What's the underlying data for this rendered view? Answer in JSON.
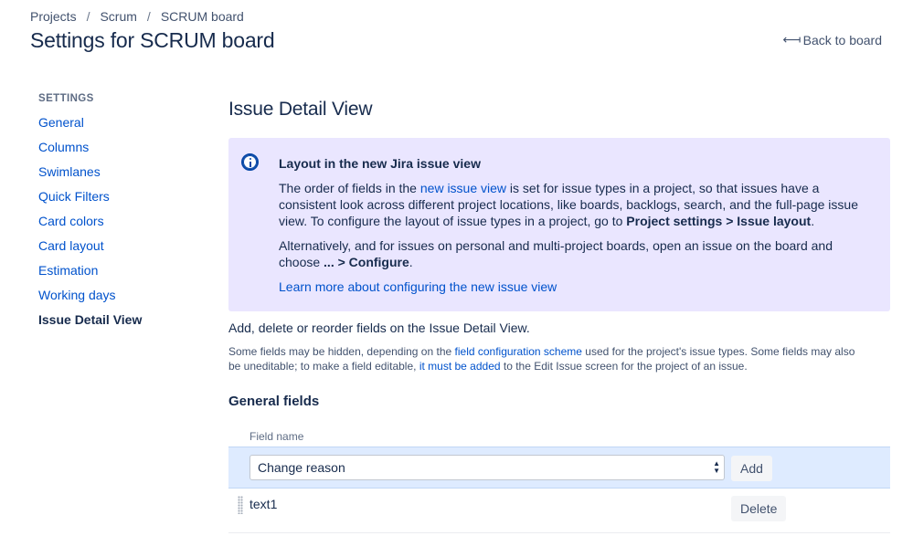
{
  "breadcrumb": [
    "Projects",
    "Scrum",
    "SCRUM board"
  ],
  "page_title": "Settings for SCRUM board",
  "back_link": "Back to board",
  "sidebar": {
    "heading": "SETTINGS",
    "items": [
      {
        "label": "General"
      },
      {
        "label": "Columns"
      },
      {
        "label": "Swimlanes"
      },
      {
        "label": "Quick Filters"
      },
      {
        "label": "Card colors"
      },
      {
        "label": "Card layout"
      },
      {
        "label": "Estimation"
      },
      {
        "label": "Working days"
      },
      {
        "label": "Issue Detail View",
        "active": true
      }
    ]
  },
  "main": {
    "heading": "Issue Detail View",
    "info": {
      "title": "Layout in the new Jira issue view",
      "p1_a": "The order of fields in the ",
      "p1_link": "new issue view",
      "p1_b": " is set for issue types in a project, so that issues have a consistent look across different project locations, like boards, backlogs, search, and the full-page issue view. To configure the layout of issue types in a project, go to ",
      "p1_bold": "Project settings > Issue layout",
      "p1_c": ".",
      "p2_a": "Alternatively, and for issues on personal and multi-project boards, open an issue on the board and choose ",
      "p2_bold": "... > Configure",
      "p2_c": ".",
      "learn_more": "Learn more about configuring the new issue view"
    },
    "desc1": "Add, delete or reorder fields on the Issue Detail View.",
    "desc2": {
      "a": "Some fields may be hidden, depending on the ",
      "link1": "field configuration scheme",
      "b": " used for the project's issue types. Some fields may also be uneditable; to make a field editable, ",
      "link2": "it must be added",
      "c": " to the Edit Issue screen for the project of an issue."
    },
    "section_title": "General fields",
    "table": {
      "column_header": "Field name",
      "select_value": "Change reason",
      "add_label": "Add",
      "rows": [
        {
          "name": "text1",
          "action": "Delete"
        }
      ]
    }
  }
}
